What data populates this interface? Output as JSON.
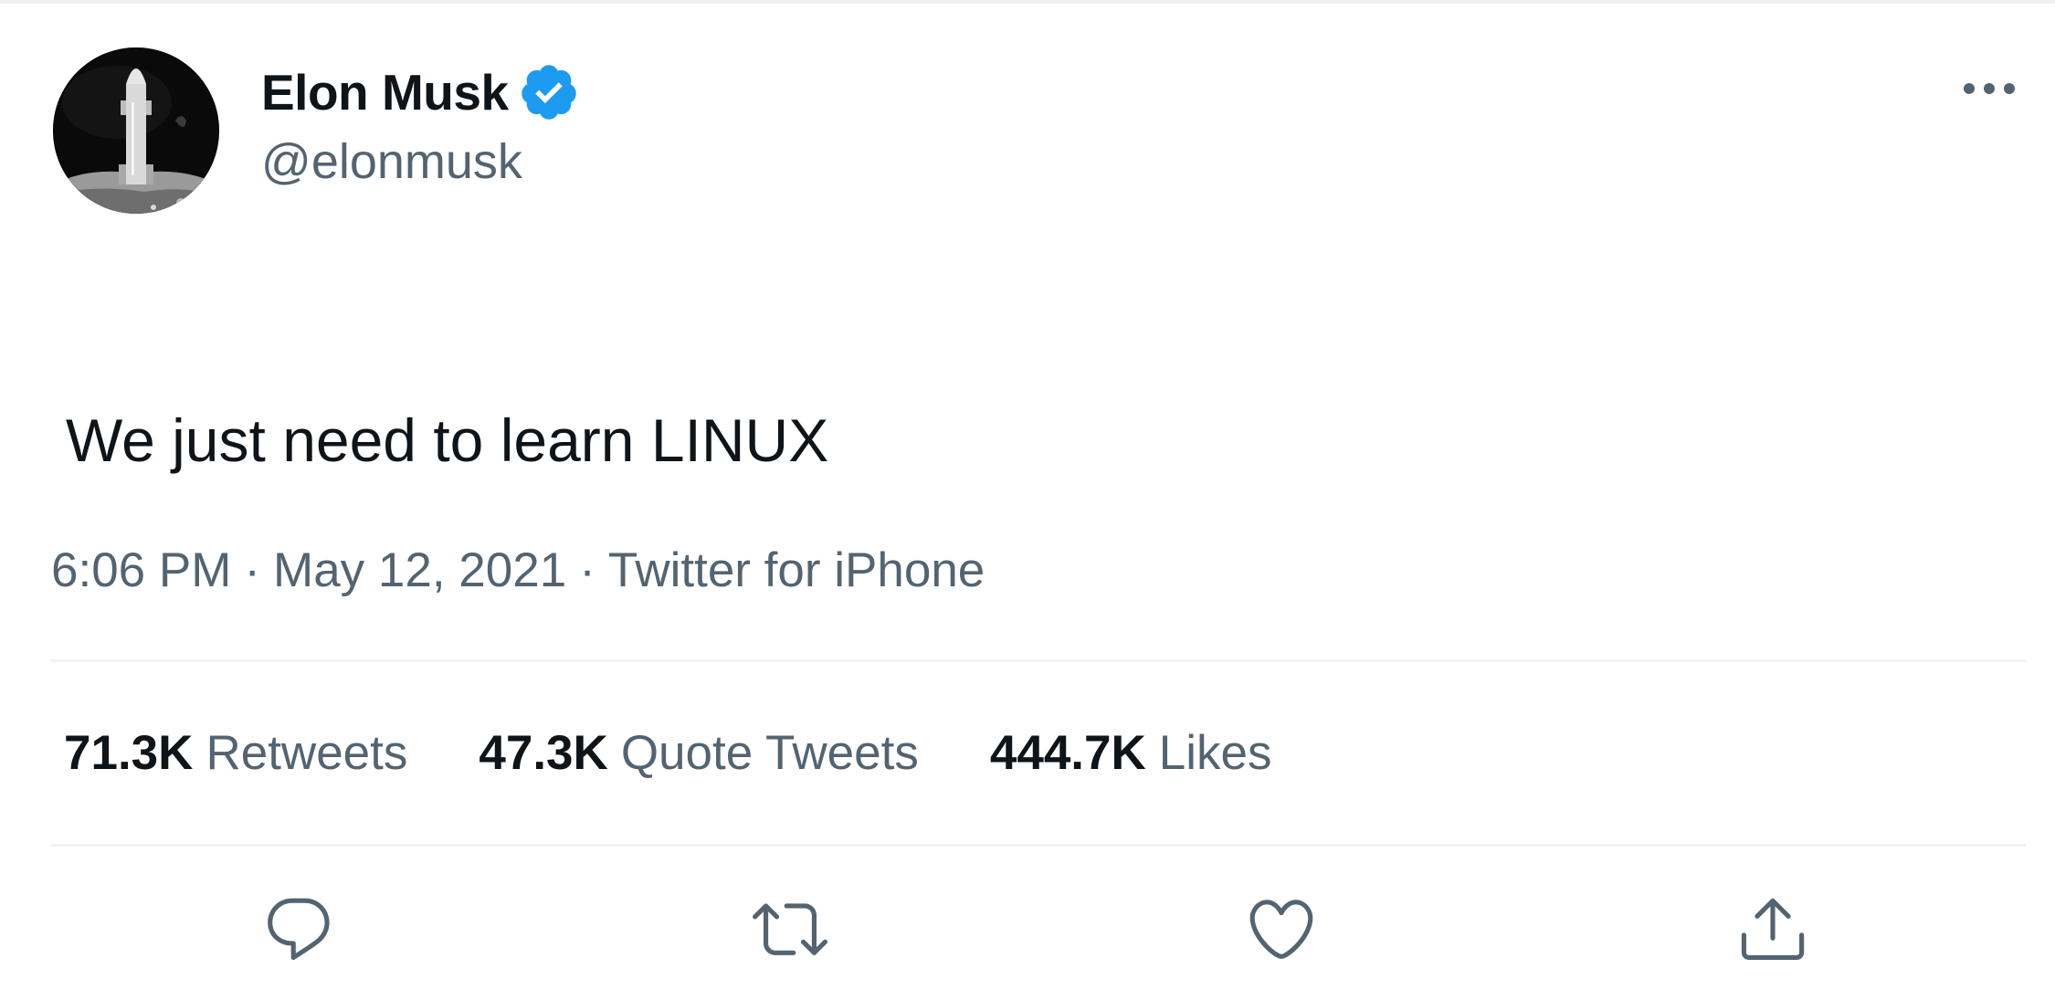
{
  "tweet": {
    "author": {
      "display_name": "Elon Musk",
      "handle": "@elonmusk",
      "verified": true,
      "avatar_icon": "avatar-starship-icon"
    },
    "text": "We just need to learn LINUX",
    "meta": {
      "time": "6:06 PM",
      "separator": "·",
      "date": "May 12, 2021",
      "source": "Twitter for iPhone"
    },
    "stats": {
      "retweets_count": "71.3K",
      "retweets_label": "Retweets",
      "quote_count": "47.3K",
      "quote_label": "Quote Tweets",
      "likes_count": "444.7K",
      "likes_label": "Likes"
    },
    "actions": [
      "reply-icon",
      "retweet-icon",
      "like-icon",
      "share-icon"
    ],
    "colors": {
      "verified_blue": "#1d9bf0",
      "secondary_text": "#536471",
      "primary_text": "#0f1419",
      "divider": "#eff3f4"
    }
  }
}
